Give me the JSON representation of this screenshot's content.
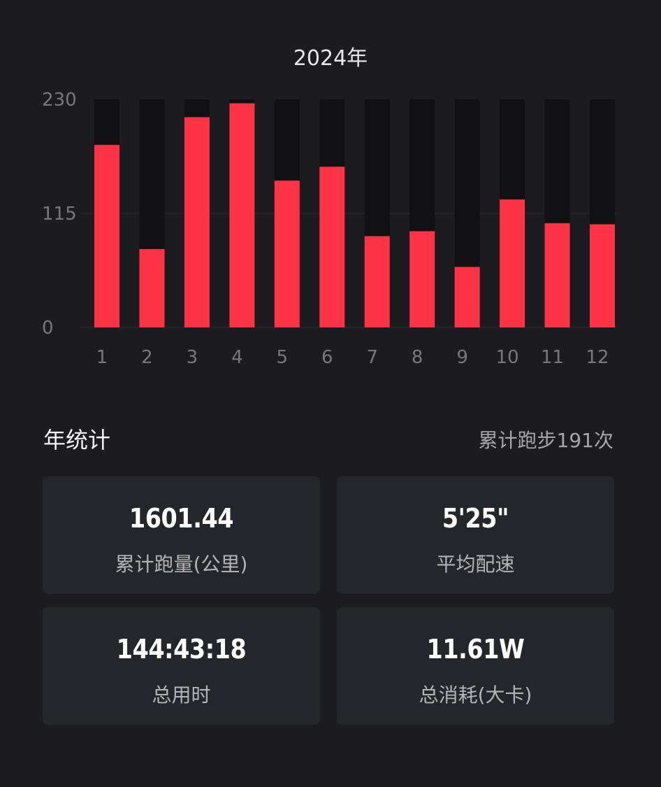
{
  "chart_data": {
    "type": "bar",
    "title": "2024年",
    "categories": [
      "1",
      "2",
      "3",
      "4",
      "5",
      "6",
      "7",
      "8",
      "9",
      "10",
      "11",
      "12"
    ],
    "values": [
      184,
      79,
      212,
      226,
      148,
      162,
      92,
      97,
      61,
      129,
      105,
      104
    ],
    "ylim": [
      0,
      230
    ],
    "y_ticks": [
      "0",
      "115",
      "230"
    ],
    "colors": {
      "bar": "#ff3346",
      "track": "#111114"
    }
  },
  "stats": {
    "title": "年统计",
    "run_count_text": "累计跑步191次",
    "cards": [
      {
        "value": "1601.44",
        "label": "累计跑量(公里)"
      },
      {
        "value": "5'25\"",
        "label": "平均配速"
      },
      {
        "value": "144:43:18",
        "label": "总用时"
      },
      {
        "value": "11.61W",
        "label": "总消耗(大卡)"
      }
    ]
  }
}
